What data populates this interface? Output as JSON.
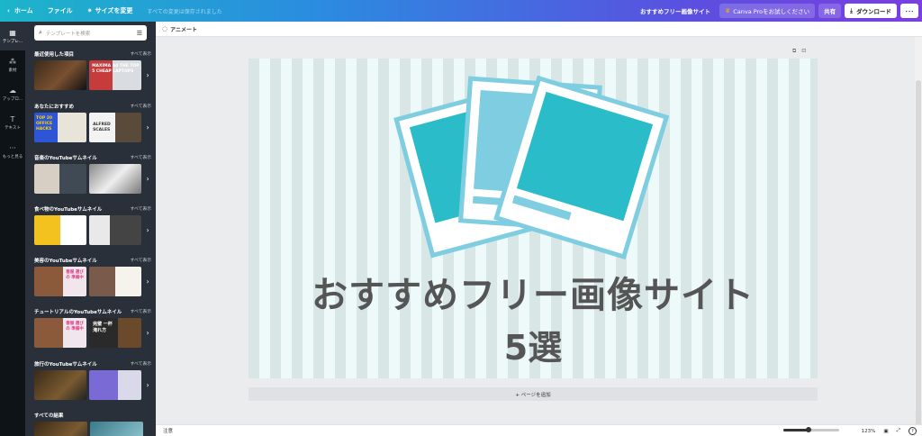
{
  "topbar": {
    "home": "ホーム",
    "file": "ファイル",
    "resize": "サイズを変更",
    "saved_status": "すべての変更は保存されました",
    "doc_title": "おすすめフリー画像サイト",
    "pro": "Canva Proをお試しください",
    "share": "共有",
    "download": "ダウンロード",
    "more": "･･･"
  },
  "rail": [
    {
      "label": "テンプレ...",
      "icon": "template-icon"
    },
    {
      "label": "素材",
      "icon": "elements-icon"
    },
    {
      "label": "アップロ...",
      "icon": "upload-icon"
    },
    {
      "label": "テキスト",
      "icon": "text-icon"
    },
    {
      "label": "もっと見る",
      "icon": "more-icon"
    }
  ],
  "panel": {
    "search_placeholder": "テンプレートを検索",
    "see_all": "すべて表示",
    "sections": [
      {
        "title": "最近使用した項目",
        "thumbs": [
          "",
          "MAXIMA A4 THE TOP 5 CHEAP LAPTOPS"
        ]
      },
      {
        "title": "あなたにおすすめ",
        "thumbs": [
          "TOP 20 OFFICE HACKS",
          "ALFRED SCALES"
        ]
      },
      {
        "title": "音楽のYouTubeサムネイル",
        "thumbs": [
          "",
          ""
        ]
      },
      {
        "title": "食べ物のYouTubeサムネイル",
        "thumbs": [
          "",
          ""
        ]
      },
      {
        "title": "美容のYouTubeサムネイル",
        "thumbs": [
          "春服 選び の 準備中",
          ""
        ]
      },
      {
        "title": "チュートリアルのYouTubeサムネイル",
        "thumbs": [
          "春服 選び の 準備中",
          "完璧 一杯 淹れ方"
        ]
      },
      {
        "title": "旅行のYouTubeサムネイル",
        "thumbs": [
          "",
          ""
        ]
      },
      {
        "title": "すべての結果",
        "thumbs": []
      }
    ]
  },
  "workspace": {
    "animate": "アニメート",
    "headline": "おすすめフリー画像サイト",
    "subline": "5選",
    "add_page": "+ ページを追加"
  },
  "bottombar": {
    "notes": "注意",
    "zoom": "123%",
    "zoom_fraction": 0.45,
    "help": "?"
  },
  "colors": {
    "accent_teal": "#2abdc9",
    "photo_border": "#7fcde0",
    "stripe_dark": "#d8e6e6",
    "stripe_light": "#eef9f9",
    "text_dark": "#555555"
  }
}
